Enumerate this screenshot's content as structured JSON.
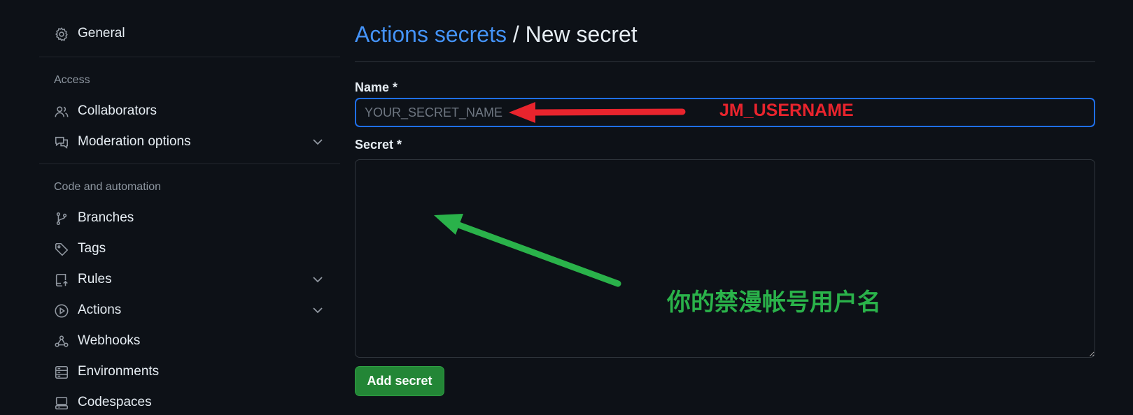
{
  "sidebar": {
    "general": {
      "label": "General",
      "icon": "gear-icon"
    },
    "sections": [
      {
        "heading": "Access"
      },
      {
        "heading": "Code and automation"
      }
    ],
    "items": [
      {
        "label": "Collaborators",
        "icon": "people-icon"
      },
      {
        "label": "Moderation options",
        "icon": "comment-discussion-icon",
        "expandable": true
      },
      {
        "label": "Branches",
        "icon": "git-branch-icon"
      },
      {
        "label": "Tags",
        "icon": "tag-icon"
      },
      {
        "label": "Rules",
        "icon": "repo-push-icon",
        "expandable": true
      },
      {
        "label": "Actions",
        "icon": "play-icon",
        "expandable": true
      },
      {
        "label": "Webhooks",
        "icon": "webhook-icon"
      },
      {
        "label": "Environments",
        "icon": "server-icon"
      },
      {
        "label": "Codespaces",
        "icon": "codespaces-icon"
      }
    ]
  },
  "main": {
    "breadcrumb_link": "Actions secrets",
    "separator": " / ",
    "title": "New secret",
    "name_label": "Name *",
    "name_placeholder": "YOUR_SECRET_NAME",
    "name_value": "",
    "secret_label": "Secret *",
    "secret_value": "",
    "add_button": "Add secret"
  },
  "annotations": {
    "red_text": "JM_USERNAME",
    "green_text": "你的禁漫帐号用户名",
    "red_color": "#e8242d",
    "green_color": "#2ab24a"
  },
  "colors": {
    "background": "#0d1117",
    "link": "#4493f8",
    "focus_border": "#1f6feb",
    "button_green": "#238636"
  }
}
